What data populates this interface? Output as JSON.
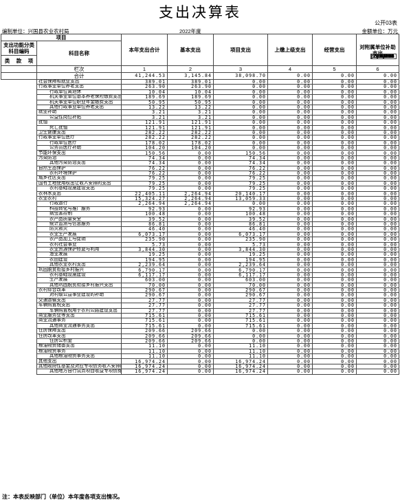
{
  "title": "支出决算表",
  "form_code": "公开03表",
  "meta": {
    "unit": "编制单位：兴国县农业农村局",
    "year": "2022年度",
    "currency": "金额单位：万元"
  },
  "headers": {
    "item": "项目",
    "func_code": "支出功能分类科目编码",
    "lei": "类",
    "kuan": "款",
    "xiang": "项",
    "subject_name": "科目名称",
    "total": "本年支出合计",
    "basic": "基本支出",
    "project": "项目支出",
    "upper": "上缴上级支出",
    "business": "经营支出",
    "subsidy": "对附属单位补助支出",
    "col_label": "栏次",
    "col_nums": [
      "1",
      "2",
      "3",
      "4",
      "5",
      "6"
    ],
    "total_label": "合计",
    "total_values": [
      "41,244.53",
      "3,145.84",
      "38,098.70",
      "0.00",
      "0.00",
      "0.00"
    ]
  },
  "rows": [
    {
      "code": "208",
      "name": "社会保障和就业支出",
      "indent": 0,
      "v": [
        "389.01",
        "389.01",
        "0.00",
        "0.00",
        "0.00",
        "0.00"
      ]
    },
    {
      "code": "20805",
      "name": "行政事业单位养老支出",
      "indent": 0,
      "v": [
        "263.90",
        "263.90",
        "0.00",
        "0.00",
        "0.00",
        "0.00"
      ]
    },
    {
      "code": "2080501",
      "name": "行政单位离退休",
      "indent": 2,
      "v": [
        "10.04",
        "10.04",
        "0.00",
        "0.00",
        "0.00",
        "0.00"
      ]
    },
    {
      "code": "2080505",
      "name": "机关事业单位基本养老保险缴费支出",
      "indent": 2,
      "v": [
        "189.69",
        "189.69",
        "0.00",
        "0.00",
        "0.00",
        "0.00"
      ]
    },
    {
      "code": "2080506",
      "name": "机关事业单位职业年金缴费支出",
      "indent": 2,
      "v": [
        "50.95",
        "50.95",
        "0.00",
        "0.00",
        "0.00",
        "0.00"
      ]
    },
    {
      "code": "2080599",
      "name": "其他行政事业单位养老支出",
      "indent": 2,
      "v": [
        "13.22",
        "13.22",
        "0.00",
        "0.00",
        "0.00",
        "0.00"
      ]
    },
    {
      "code": "20807",
      "name": "就业补助",
      "indent": 0,
      "v": [
        "3.21",
        "3.21",
        "0.00",
        "0.00",
        "0.00",
        "0.00"
      ]
    },
    {
      "code": "2080705",
      "name": "公益性岗位补贴",
      "indent": 2,
      "v": [
        "3.21",
        "3.21",
        "0.00",
        "0.00",
        "0.00",
        "0.00"
      ]
    },
    {
      "code": "20808",
      "name": "抚恤",
      "indent": 0,
      "v": [
        "121.91",
        "121.91",
        "0.00",
        "0.00",
        "0.00",
        "0.00"
      ]
    },
    {
      "code": "2080801",
      "name": "死亡抚恤",
      "indent": 2,
      "v": [
        "121.91",
        "121.91",
        "0.00",
        "0.00",
        "0.00",
        "0.00"
      ]
    },
    {
      "code": "210",
      "name": "卫生健康支出",
      "indent": 0,
      "v": [
        "282.22",
        "282.22",
        "0.00",
        "0.00",
        "0.00",
        "0.00"
      ]
    },
    {
      "code": "21011",
      "name": "行政事业单位医疗",
      "indent": 0,
      "v": [
        "282.22",
        "282.22",
        "0.00",
        "0.00",
        "0.00",
        "0.00"
      ]
    },
    {
      "code": "2101101",
      "name": "行政单位医疗",
      "indent": 2,
      "v": [
        "178.02",
        "178.02",
        "0.00",
        "0.00",
        "0.00",
        "0.00"
      ]
    },
    {
      "code": "2101103",
      "name": "公务员医疗补助",
      "indent": 2,
      "v": [
        "104.20",
        "104.20",
        "0.00",
        "0.00",
        "0.00",
        "0.00"
      ]
    },
    {
      "code": "211",
      "name": "节能环保支出",
      "indent": 0,
      "v": [
        "150.56",
        "0.00",
        "150.56",
        "0.00",
        "0.00",
        "0.00"
      ]
    },
    {
      "code": "21103",
      "name": "污染防治",
      "indent": 0,
      "v": [
        "74.34",
        "0.00",
        "74.34",
        "0.00",
        "0.00",
        "0.00"
      ]
    },
    {
      "code": "2110399",
      "name": "其他污染防治支出",
      "indent": 2,
      "v": [
        "74.34",
        "0.00",
        "74.34",
        "0.00",
        "0.00",
        "0.00"
      ]
    },
    {
      "code": "21104",
      "name": "自然生态保护",
      "indent": 0,
      "v": [
        "76.22",
        "0.00",
        "76.22",
        "0.00",
        "0.00",
        "0.00"
      ]
    },
    {
      "code": "2110402",
      "name": "农村环境保护",
      "indent": 2,
      "v": [
        "76.22",
        "0.00",
        "76.22",
        "0.00",
        "0.00",
        "0.00"
      ]
    },
    {
      "code": "212",
      "name": "城乡社区支出",
      "indent": 0,
      "v": [
        "79.25",
        "0.00",
        "79.25",
        "0.00",
        "0.00",
        "0.00"
      ]
    },
    {
      "code": "21208",
      "name": "国有土地使用权出让收入安排的支出",
      "indent": 0,
      "v": [
        "79.25",
        "0.00",
        "79.25",
        "0.00",
        "0.00",
        "0.00"
      ]
    },
    {
      "code": "2120804",
      "name": "农村基础设施建设支出",
      "indent": 2,
      "v": [
        "79.25",
        "0.00",
        "79.25",
        "0.00",
        "0.00",
        "0.00"
      ]
    },
    {
      "code": "213",
      "name": "农林水支出",
      "indent": 0,
      "v": [
        "22,405.11",
        "2,264.94",
        "20,140.17",
        "0.00",
        "0.00",
        "0.00"
      ]
    },
    {
      "code": "21301",
      "name": "农业农村",
      "indent": 0,
      "v": [
        "15,324.27",
        "2,264.94",
        "13,059.33",
        "0.00",
        "0.00",
        "0.00"
      ]
    },
    {
      "code": "2130101",
      "name": "行政运行",
      "indent": 2,
      "v": [
        "2,264.94",
        "2,264.94",
        "0.00",
        "0.00",
        "0.00",
        "0.00"
      ]
    },
    {
      "code": "2130106",
      "name": "科技转化与推广服务",
      "indent": 2,
      "v": [
        "92.93",
        "0.00",
        "92.93",
        "0.00",
        "0.00",
        "0.00"
      ]
    },
    {
      "code": "2130108",
      "name": "病虫害控制",
      "indent": 2,
      "v": [
        "100.48",
        "0.00",
        "100.48",
        "0.00",
        "0.00",
        "0.00"
      ]
    },
    {
      "code": "2130109",
      "name": "农产品质量安全",
      "indent": 2,
      "v": [
        "39.52",
        "0.00",
        "39.52",
        "0.00",
        "0.00",
        "0.00"
      ]
    },
    {
      "code": "2130111",
      "name": "统计监测与信息服务",
      "indent": 2,
      "v": [
        "86.81",
        "0.00",
        "86.81",
        "0.00",
        "0.00",
        "0.00"
      ]
    },
    {
      "code": "2130119",
      "name": "防灾救灾",
      "indent": 2,
      "v": [
        "46.40",
        "0.00",
        "46.40",
        "0.00",
        "0.00",
        "0.00"
      ]
    },
    {
      "code": "2130122",
      "name": "农业生产发展",
      "indent": 2,
      "v": [
        "6,073.17",
        "0.00",
        "6,073.17",
        "0.00",
        "0.00",
        "0.00"
      ]
    },
    {
      "code": "2130125",
      "name": "农产品加工与促销",
      "indent": 2,
      "v": [
        "235.90",
        "0.00",
        "235.90",
        "0.00",
        "0.00",
        "0.00"
      ]
    },
    {
      "code": "2130126",
      "name": "农村社会事业",
      "indent": 2,
      "v": [
        "5.73",
        "0.00",
        "5.73",
        "0.00",
        "0.00",
        "0.00"
      ]
    },
    {
      "code": "2130135",
      "name": "农业资源保护修复与利用",
      "indent": 2,
      "v": [
        "3,844.30",
        "0.00",
        "3,844.30",
        "0.00",
        "0.00",
        "0.00"
      ]
    },
    {
      "code": "2130148",
      "name": "渔业发展",
      "indent": 2,
      "v": [
        "19.25",
        "0.00",
        "19.25",
        "0.00",
        "0.00",
        "0.00"
      ]
    },
    {
      "code": "2130153",
      "name": "农田建设",
      "indent": 2,
      "v": [
        "194.95",
        "0.00",
        "194.95",
        "0.00",
        "0.00",
        "0.00"
      ]
    },
    {
      "code": "2130199",
      "name": "其他农业农村支出",
      "indent": 2,
      "v": [
        "2,239.64",
        "0.00",
        "2,239.64",
        "0.00",
        "0.00",
        "0.00"
      ]
    },
    {
      "code": "21305",
      "name": "巩固脱贫衔接乡村振兴",
      "indent": 0,
      "v": [
        "6,790.17",
        "0.00",
        "6,790.17",
        "0.00",
        "0.00",
        "0.00"
      ]
    },
    {
      "code": "2130504",
      "name": "农村基础设施建设",
      "indent": 2,
      "v": [
        "6,117.17",
        "0.00",
        "6,117.17",
        "0.00",
        "0.00",
        "0.00"
      ]
    },
    {
      "code": "2130505",
      "name": "生产发展",
      "indent": 2,
      "v": [
        "603.00",
        "0.00",
        "603.00",
        "0.00",
        "0.00",
        "0.00"
      ]
    },
    {
      "code": "2130599",
      "name": "其他巩固脱贫衔接乡村振兴支出",
      "indent": 2,
      "v": [
        "70.00",
        "0.00",
        "70.00",
        "0.00",
        "0.00",
        "0.00"
      ]
    },
    {
      "code": "21307",
      "name": "农村综合改革",
      "indent": 0,
      "v": [
        "290.67",
        "0.00",
        "290.67",
        "0.00",
        "0.00",
        "0.00"
      ]
    },
    {
      "code": "2130701",
      "name": "对村级公益事业建设的补助",
      "indent": 2,
      "v": [
        "290.67",
        "0.00",
        "290.67",
        "0.00",
        "0.00",
        "0.00"
      ]
    },
    {
      "code": "214",
      "name": "交通运输支出",
      "indent": 0,
      "v": [
        "27.77",
        "0.00",
        "27.77",
        "0.00",
        "0.00",
        "0.00"
      ]
    },
    {
      "code": "21406",
      "name": "车辆购置税支出",
      "indent": 0,
      "v": [
        "27.77",
        "0.00",
        "27.77",
        "0.00",
        "0.00",
        "0.00"
      ]
    },
    {
      "code": "2140602",
      "name": "车辆购置税用于农村公路建设支出",
      "indent": 2,
      "v": [
        "27.77",
        "0.00",
        "27.77",
        "0.00",
        "0.00",
        "0.00"
      ]
    },
    {
      "code": "216",
      "name": "商业服务业等支出",
      "indent": 0,
      "v": [
        "715.61",
        "0.00",
        "715.61",
        "0.00",
        "0.00",
        "0.00"
      ]
    },
    {
      "code": "21602",
      "name": "商业流通事务",
      "indent": 0,
      "v": [
        "715.61",
        "0.00",
        "715.61",
        "0.00",
        "0.00",
        "0.00"
      ]
    },
    {
      "code": "2160299",
      "name": "其他商业流通事务支出",
      "indent": 2,
      "v": [
        "715.61",
        "0.00",
        "715.61",
        "0.00",
        "0.00",
        "0.00"
      ]
    },
    {
      "code": "221",
      "name": "住房保障支出",
      "indent": 0,
      "v": [
        "209.66",
        "209.66",
        "0.00",
        "0.00",
        "0.00",
        "0.00"
      ]
    },
    {
      "code": "22102",
      "name": "住房改革支出",
      "indent": 0,
      "v": [
        "209.66",
        "209.66",
        "0.00",
        "0.00",
        "0.00",
        "0.00"
      ]
    },
    {
      "code": "2210201",
      "name": "住房公积金",
      "indent": 2,
      "v": [
        "209.66",
        "209.66",
        "0.00",
        "0.00",
        "0.00",
        "0.00"
      ]
    },
    {
      "code": "222",
      "name": "粮油物资储备支出",
      "indent": 0,
      "v": [
        "11.10",
        "0.00",
        "11.10",
        "0.00",
        "0.00",
        "0.00"
      ]
    },
    {
      "code": "22201",
      "name": "粮油物资事务",
      "indent": 0,
      "v": [
        "11.10",
        "0.00",
        "11.10",
        "0.00",
        "0.00",
        "0.00"
      ]
    },
    {
      "code": "2220199",
      "name": "其他粮油物资事务支出",
      "indent": 2,
      "v": [
        "11.10",
        "0.00",
        "11.10",
        "0.00",
        "0.00",
        "0.00"
      ]
    },
    {
      "code": "229",
      "name": "其他支出",
      "indent": 0,
      "v": [
        "16,974.24",
        "0.00",
        "16,974.24",
        "0.00",
        "0.00",
        "0.00"
      ]
    },
    {
      "code": "22904",
      "name": "其他政府性基金及对应专项债务收入安排的支出",
      "indent": 0,
      "v": [
        "16,974.24",
        "0.00",
        "16,974.24",
        "0.00",
        "0.00",
        "0.00"
      ]
    },
    {
      "code": "2290402",
      "name": "其他地方自行试点项目收益专项债券收入安排的支出",
      "indent": 2,
      "v": [
        "16,974.24",
        "0.00",
        "16,974.24",
        "0.00",
        "0.00",
        "0.00"
      ]
    }
  ],
  "note": "注：本表反映部门（单位）本年度各项支出情况。"
}
